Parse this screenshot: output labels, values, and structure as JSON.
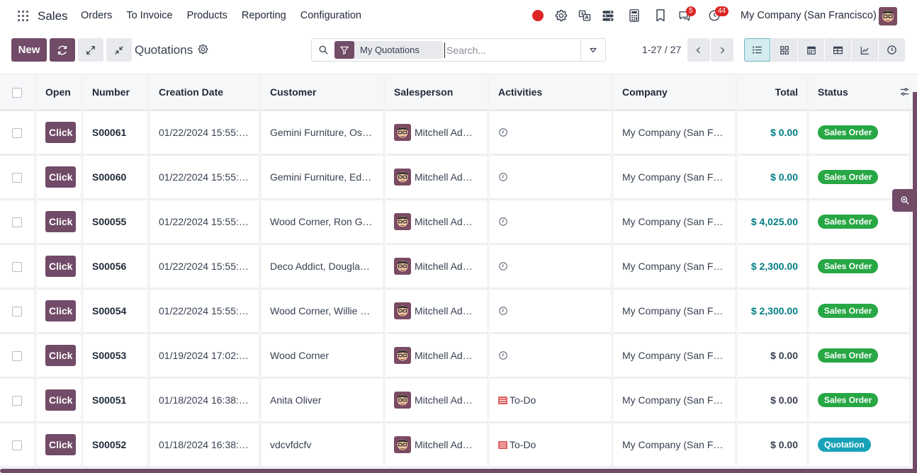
{
  "navbar": {
    "app_name": "Sales",
    "menu": [
      "Orders",
      "To Invoice",
      "Products",
      "Reporting",
      "Configuration"
    ],
    "messages_count": "5",
    "activities_count": "44",
    "company": "My Company (San Francisco)"
  },
  "control_panel": {
    "new_label": "New",
    "title": "Quotations",
    "search": {
      "facet": "My Quotations",
      "placeholder": "Search..."
    },
    "pager": "1-27 / 27",
    "views": [
      "list",
      "kanban",
      "calendar",
      "pivot",
      "graph",
      "activity"
    ],
    "active_view": "list"
  },
  "table": {
    "columns": [
      "Open",
      "Number",
      "Creation Date",
      "Customer",
      "Salesperson",
      "Activities",
      "Company",
      "Total",
      "Status"
    ],
    "open_button_label": "Click",
    "rows": [
      {
        "number": "S00061",
        "date": "01/22/2024 15:55:…",
        "customer": "Gemini Furniture, Osc…",
        "salesperson": "Mitchell Adm…",
        "activity": "",
        "company": "My Company (San Fra…",
        "total": "$ 0.00",
        "status": "Sales Order",
        "total_style": "strong",
        "status_style": "so"
      },
      {
        "number": "S00060",
        "date": "01/22/2024 15:55:…",
        "customer": "Gemini Furniture, Edwi…",
        "salesperson": "Mitchell Adm…",
        "activity": "",
        "company": "My Company (San Fra…",
        "total": "$ 0.00",
        "status": "Sales Order",
        "total_style": "strong",
        "status_style": "so"
      },
      {
        "number": "S00055",
        "date": "01/22/2024 15:55:…",
        "customer": "Wood Corner, Ron Gib…",
        "salesperson": "Mitchell Adm…",
        "activity": "",
        "company": "My Company (San Fra…",
        "total": "$ 4,025.00",
        "status": "Sales Order",
        "total_style": "strong",
        "status_style": "so"
      },
      {
        "number": "S00056",
        "date": "01/22/2024 15:55:…",
        "customer": "Deco Addict, Douglas …",
        "salesperson": "Mitchell Adm…",
        "activity": "",
        "company": "My Company (San Fra…",
        "total": "$ 2,300.00",
        "status": "Sales Order",
        "total_style": "strong",
        "status_style": "so"
      },
      {
        "number": "S00054",
        "date": "01/22/2024 15:55:…",
        "customer": "Wood Corner, Willie B…",
        "salesperson": "Mitchell Adm…",
        "activity": "",
        "company": "My Company (San Fra…",
        "total": "$ 2,300.00",
        "status": "Sales Order",
        "total_style": "strong",
        "status_style": "so"
      },
      {
        "number": "S00053",
        "date": "01/19/2024 17:02:…",
        "customer": "Wood Corner",
        "salesperson": "Mitchell Adm…",
        "activity": "",
        "company": "My Company (San Fra…",
        "total": "$ 0.00",
        "status": "Sales Order",
        "total_style": "muted",
        "status_style": "so"
      },
      {
        "number": "S00051",
        "date": "01/18/2024 16:38:…",
        "customer": "Anita Oliver",
        "salesperson": "Mitchell Adm…",
        "activity": "To-Do",
        "company": "My Company (San Fra…",
        "total": "$ 0.00",
        "status": "Sales Order",
        "total_style": "muted",
        "status_style": "so"
      },
      {
        "number": "S00052",
        "date": "01/18/2024 16:38:…",
        "customer": "vdcvfdcfv",
        "salesperson": "Mitchell Adm…",
        "activity": "To-Do",
        "company": "My Company (San Fra…",
        "total": "$ 0.00",
        "status": "Quotation",
        "total_style": "muted",
        "status_style": "q"
      }
    ]
  },
  "colors": {
    "brand": "#714b67",
    "accent_total": "#017e84",
    "status_sales_order": "#28a745",
    "status_quotation": "#17a2b8",
    "notification_badge": "#dc2626"
  }
}
